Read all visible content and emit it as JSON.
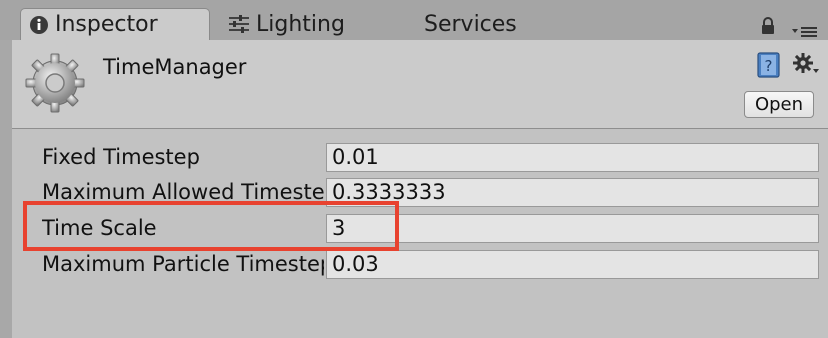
{
  "tabs": [
    {
      "label": "Inspector",
      "icon": "info-icon"
    },
    {
      "label": "Lighting",
      "icon": "sliders-icon"
    },
    {
      "label": "Services"
    }
  ],
  "header": {
    "title": "TimeManager",
    "open_label": "Open"
  },
  "properties": [
    {
      "label": "Fixed Timestep",
      "value": "0.01"
    },
    {
      "label": "Maximum Allowed Timestep",
      "value": "0.3333333"
    },
    {
      "label": "Time Scale",
      "value": "3"
    },
    {
      "label": "Maximum Particle Timestep",
      "value": "0.03"
    }
  ],
  "colors": {
    "highlight": "#e8422f",
    "panel": "#c2c2c2",
    "tab_active": "#cbcbcb"
  }
}
